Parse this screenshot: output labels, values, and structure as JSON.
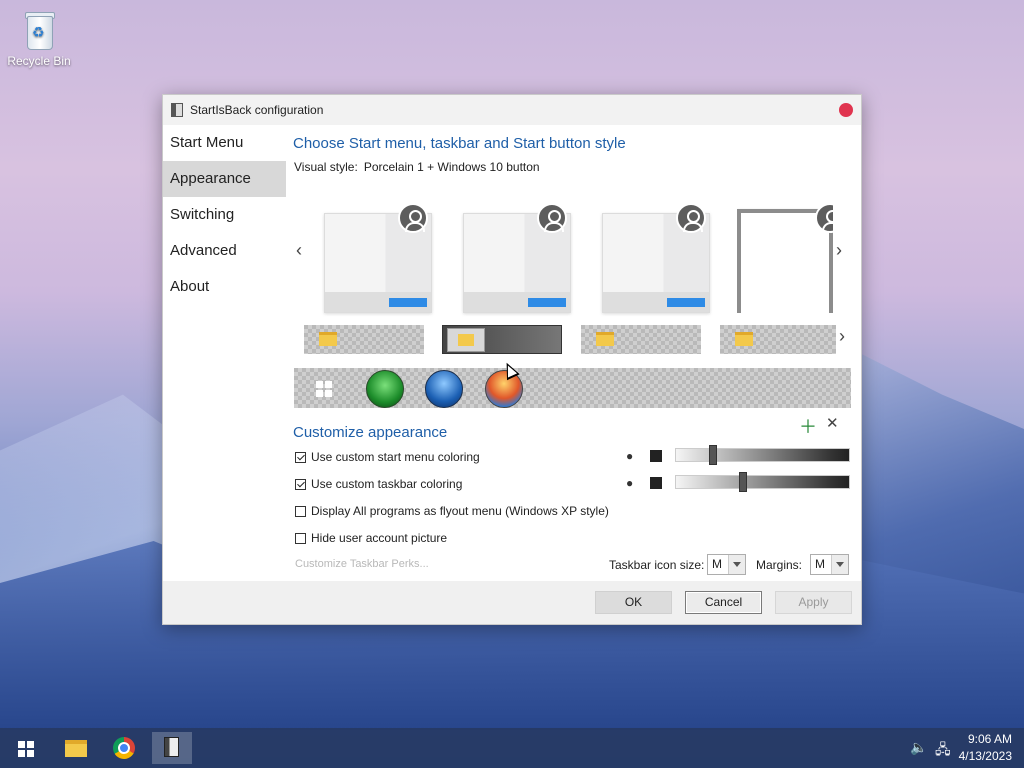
{
  "desktop": {
    "icons": [
      {
        "label": "Recycle Bin",
        "icon": "recycle-bin-icon"
      }
    ]
  },
  "window": {
    "title": "StartIsBack configuration",
    "sidebar": {
      "items": [
        {
          "label": "Start Menu",
          "active": false
        },
        {
          "label": "Appearance",
          "active": true
        },
        {
          "label": "Switching",
          "active": false
        },
        {
          "label": "Advanced",
          "active": false
        },
        {
          "label": "About",
          "active": false
        }
      ]
    },
    "main": {
      "heading": "Choose Start menu, taskbar and Start button style",
      "visual_style_label": "Visual style:",
      "visual_style_value": "Porcelain 1 + Windows 10 button",
      "customize_heading": "Customize appearance",
      "options": [
        {
          "label": "Use custom start menu coloring",
          "checked": true
        },
        {
          "label": "Use custom taskbar coloring",
          "checked": true
        },
        {
          "label": "Display All programs as flyout menu (Windows XP style)",
          "checked": false
        },
        {
          "label": "Hide user account picture",
          "checked": false
        }
      ],
      "customize_perks": "Customize Taskbar Perks...",
      "taskbar_icon_size_label": "Taskbar icon size:",
      "taskbar_icon_size_value": "M",
      "margins_label": "Margins:",
      "margins_value": "M",
      "start_menu_slider": 0.2,
      "taskbar_slider": 0.38
    },
    "footer": {
      "ok": "OK",
      "cancel": "Cancel",
      "apply": "Apply"
    }
  },
  "taskbar": {
    "time": "9:06 AM",
    "date": "4/13/2023"
  },
  "colors": {
    "accent": "#1f5fa8",
    "close": "#e0344f"
  }
}
